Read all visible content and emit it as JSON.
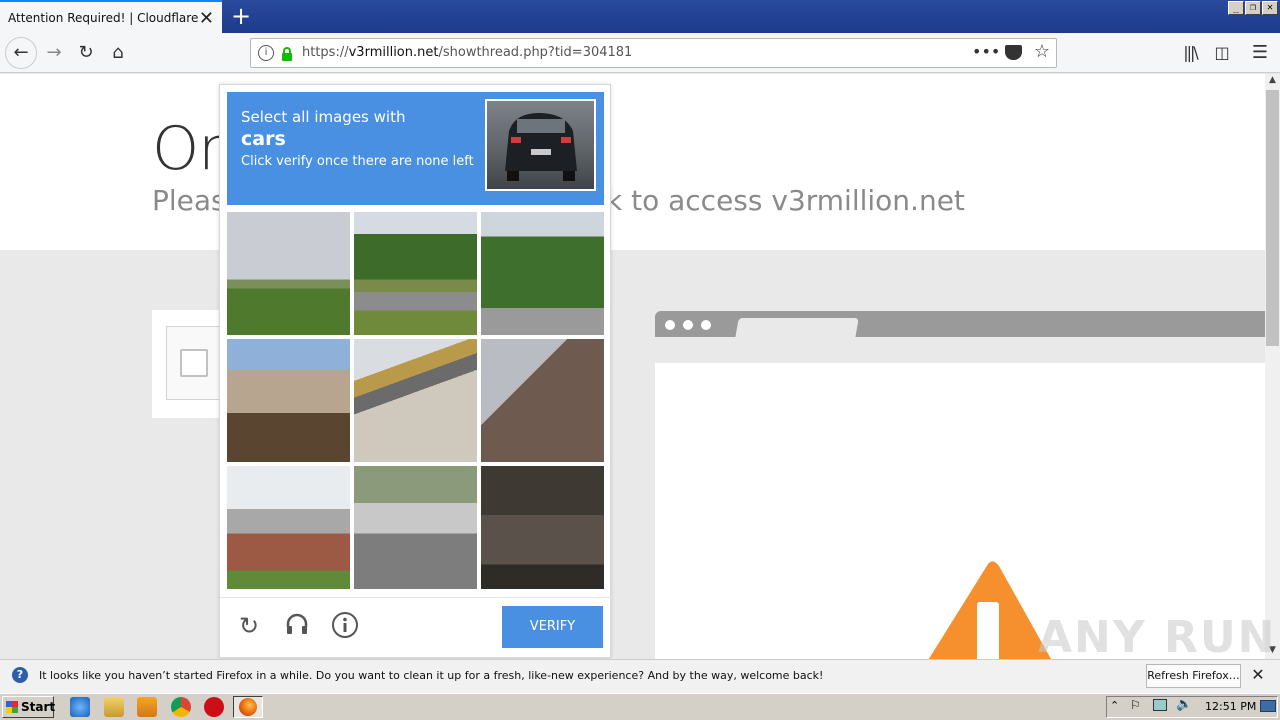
{
  "browser": {
    "tab_title": "Attention Required! | Cloudflare",
    "url_prefix": "https://",
    "url_domain": "v3rmillion.net",
    "url_path": "/showthread.php?tid=304181"
  },
  "page": {
    "heading": "On",
    "subtitle_left": "Pleas",
    "subtitle_right": "k to access v3rmillion.net"
  },
  "captcha": {
    "prompt": "Select all images with",
    "target": "cars",
    "hint": "Click verify once there are none left",
    "verify_label": "VERIFY",
    "tiles": [
      {
        "name": "field-road"
      },
      {
        "name": "trees-road"
      },
      {
        "name": "tree-power-lines"
      },
      {
        "name": "stone-wall"
      },
      {
        "name": "bridge"
      },
      {
        "name": "roof"
      },
      {
        "name": "house-steps"
      },
      {
        "name": "sidewalk-bikes"
      },
      {
        "name": "dark-steps"
      }
    ]
  },
  "notification": {
    "text": "It looks like you haven’t started Firefox in a while. Do you want to clean it up for a fresh, like-new experience? And by the way, welcome back!",
    "button_label": "Refresh Firefox…"
  },
  "taskbar": {
    "start_label": "Start",
    "clock": "12:51 PM"
  },
  "watermark": "ANY RUN",
  "colors": {
    "captcha_blue": "#4a90e2",
    "warning_orange": "#f6902f"
  }
}
